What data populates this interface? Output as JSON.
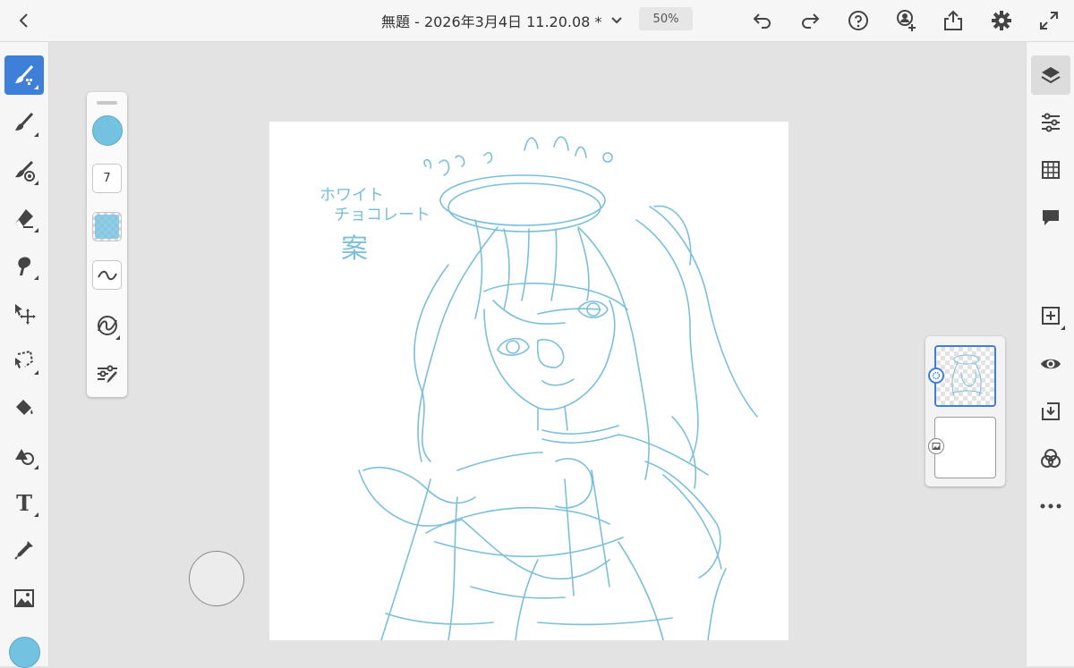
{
  "document": {
    "title": "無題 - 2026年3月4日 11.20.08 *",
    "zoom": "50%"
  },
  "toolbar": {
    "back": "chevron-left-icon",
    "title_menu": "chevron-down-icon",
    "undo": "undo-icon",
    "redo": "redo-icon",
    "help": "help-icon",
    "invite": "add-person-icon",
    "share": "share-icon",
    "settings": "gear-icon",
    "fullscreen": "expand-icon"
  },
  "tools": [
    {
      "id": "paint",
      "icon": "paint-brush-icon",
      "active": true
    },
    {
      "id": "brush",
      "icon": "brush-icon"
    },
    {
      "id": "mixer",
      "icon": "mixer-brush-icon"
    },
    {
      "id": "eraser",
      "icon": "eraser-icon"
    },
    {
      "id": "smudge",
      "icon": "smudge-icon"
    },
    {
      "id": "move",
      "icon": "move-icon"
    },
    {
      "id": "lasso",
      "icon": "lasso-icon"
    },
    {
      "id": "fill",
      "icon": "fill-icon"
    },
    {
      "id": "shapes",
      "icon": "shapes-icon"
    },
    {
      "id": "type",
      "icon": "type-icon",
      "glyph": "T"
    },
    {
      "id": "eyedropper",
      "icon": "eyedropper-icon"
    },
    {
      "id": "image",
      "icon": "image-icon"
    }
  ],
  "brush_panel": {
    "color": "#74c2e1",
    "size": "7",
    "opacity_color": "#74c2e1"
  },
  "right_tools": [
    {
      "id": "layers",
      "icon": "layers-icon",
      "active": true
    },
    {
      "id": "properties",
      "icon": "sliders-icon"
    },
    {
      "id": "grid",
      "icon": "grid-icon"
    },
    {
      "id": "comments",
      "icon": "comment-icon"
    },
    {
      "id": "add-layer",
      "icon": "add-layer-icon"
    },
    {
      "id": "visibility",
      "icon": "eye-icon"
    },
    {
      "id": "merge",
      "icon": "merge-down-icon"
    },
    {
      "id": "blend",
      "icon": "blend-modes-icon"
    },
    {
      "id": "more",
      "icon": "more-icon"
    }
  ],
  "canvas": {
    "ink": "#7cbfdb",
    "note_line1": "ホワイト",
    "note_line2": "チョコレート",
    "note_line3": "案"
  },
  "layers": [
    {
      "name": "sketch-layer",
      "selected": true
    },
    {
      "name": "background-layer",
      "selected": false
    }
  ],
  "colors": {
    "accent": "#3d7fd9",
    "current_color": "#74c2e1"
  }
}
